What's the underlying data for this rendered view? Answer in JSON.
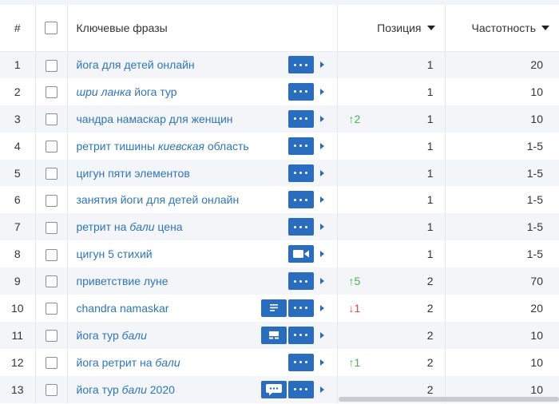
{
  "columns": {
    "number": "#",
    "keywords": "Ключевые фразы",
    "position": "Позиция",
    "frequency": "Частотность"
  },
  "rows": [
    {
      "num": "1",
      "kw": [
        {
          "t": "йога для детей онлайн",
          "i": false
        }
      ],
      "extra": null,
      "delta": "",
      "dir": "",
      "pos": "1",
      "freq": "20"
    },
    {
      "num": "2",
      "kw": [
        {
          "t": "шри ланка",
          "i": true
        },
        {
          "t": " йога тур",
          "i": false
        }
      ],
      "extra": null,
      "delta": "",
      "dir": "",
      "pos": "1",
      "freq": "10"
    },
    {
      "num": "3",
      "kw": [
        {
          "t": "чандра намаскар для женщин",
          "i": false
        }
      ],
      "extra": null,
      "delta": "2",
      "dir": "up",
      "pos": "1",
      "freq": "10"
    },
    {
      "num": "4",
      "kw": [
        {
          "t": "ретрит тишины ",
          "i": false
        },
        {
          "t": "киевская",
          "i": true
        },
        {
          "t": " область",
          "i": false
        }
      ],
      "extra": null,
      "delta": "",
      "dir": "",
      "pos": "1",
      "freq": "1-5"
    },
    {
      "num": "5",
      "kw": [
        {
          "t": "цигун пяти элементов",
          "i": false
        }
      ],
      "extra": null,
      "delta": "",
      "dir": "",
      "pos": "1",
      "freq": "1-5"
    },
    {
      "num": "6",
      "kw": [
        {
          "t": "занятия йоги для детей онлайн",
          "i": false
        }
      ],
      "extra": null,
      "delta": "",
      "dir": "",
      "pos": "1",
      "freq": "1-5"
    },
    {
      "num": "7",
      "kw": [
        {
          "t": "ретрит на ",
          "i": false
        },
        {
          "t": "бали",
          "i": true
        },
        {
          "t": " цена",
          "i": false
        }
      ],
      "extra": null,
      "delta": "",
      "dir": "",
      "pos": "1",
      "freq": "1-5"
    },
    {
      "num": "8",
      "kw": [
        {
          "t": "цигун 5 стихий",
          "i": false
        }
      ],
      "extra": null,
      "main_icon": "video-icon",
      "delta": "",
      "dir": "",
      "pos": "1",
      "freq": "1-5"
    },
    {
      "num": "9",
      "kw": [
        {
          "t": "приветствие луне",
          "i": false
        }
      ],
      "extra": null,
      "delta": "5",
      "dir": "up",
      "pos": "2",
      "freq": "70"
    },
    {
      "num": "10",
      "kw": [
        {
          "t": "chandra namaskar",
          "i": false
        }
      ],
      "extra": "text-snippet-icon",
      "delta": "1",
      "dir": "down",
      "pos": "2",
      "freq": "20"
    },
    {
      "num": "11",
      "kw": [
        {
          "t": "йога тур ",
          "i": false
        },
        {
          "t": "бали",
          "i": true
        }
      ],
      "extra": "image-snippet-icon",
      "delta": "",
      "dir": "",
      "pos": "2",
      "freq": "10"
    },
    {
      "num": "12",
      "kw": [
        {
          "t": "йога ретрит на ",
          "i": false
        },
        {
          "t": "бали",
          "i": true
        }
      ],
      "extra": null,
      "delta": "1",
      "dir": "up",
      "pos": "2",
      "freq": "10"
    },
    {
      "num": "13",
      "kw": [
        {
          "t": "йога тур ",
          "i": false
        },
        {
          "t": "бали",
          "i": true
        },
        {
          "t": " 2020",
          "i": false
        }
      ],
      "extra": "comment-icon",
      "delta": "",
      "dir": "",
      "pos": "2",
      "freq": "10"
    }
  ],
  "colors": {
    "accent": "#2a6cbd",
    "link": "#2e75b8",
    "up": "#4caf50",
    "down": "#e04848",
    "stripe": "#f4f5f8"
  }
}
